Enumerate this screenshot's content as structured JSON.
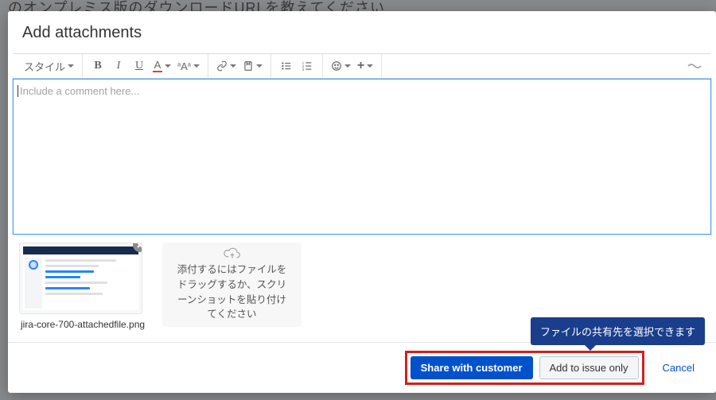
{
  "background_text": "のオンプレミス版のダウンロードURLを教えてください",
  "modal": {
    "title": "Add attachments"
  },
  "toolbar": {
    "style_label": "スタイル",
    "bold": "B",
    "italic": "I",
    "underline": "U",
    "textcolor": "A",
    "subsuper": "ᵃAᵃ"
  },
  "editor": {
    "placeholder": "Include a comment here..."
  },
  "attachment": {
    "filename": "jira-core-700-attachedfile.png"
  },
  "dropzone": {
    "text": "添付するにはファイルをドラッグするか、スクリーンショットを貼り付けてください"
  },
  "callout": {
    "text": "ファイルの共有先を選択できます"
  },
  "footer": {
    "primary": "Share with customer",
    "secondary": "Add to issue only",
    "cancel": "Cancel"
  }
}
